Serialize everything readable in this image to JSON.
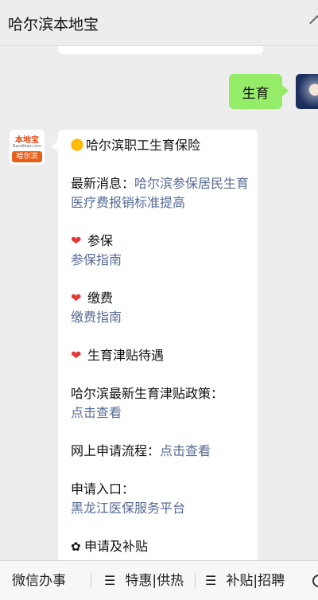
{
  "header": {
    "title": "哈尔滨本地宝"
  },
  "chat": {
    "outgoing_message": "生育",
    "bot_avatar": {
      "top_text": "本地宝",
      "url_text": "Bendibao.com",
      "city_text": "哈尔滨"
    },
    "reply": {
      "title": "哈尔滨职工生育保险",
      "latest_news_label": "最新消息：",
      "latest_news_link": "哈尔滨参保居民生育医疗费报销标准提高",
      "section1_title": "参保",
      "section1_link": "参保指南",
      "section2_title": "缴费",
      "section2_link": "缴费指南",
      "section3_title": "生育津贴待遇",
      "policy_label": "哈尔滨最新生育津贴政策：",
      "policy_link": "点击查看",
      "online_label": "网上申请流程：",
      "online_link": "点击查看",
      "entry_label": "申请入口：",
      "entry_link": "黑龙江医保服务平台",
      "section4_title": "申请及补贴"
    }
  },
  "bottom_menu": [
    {
      "label": "微信办事",
      "has_menu_icon": false
    },
    {
      "label": "特惠|供热",
      "has_menu_icon": true
    },
    {
      "label": "补贴|招聘",
      "has_menu_icon": true
    }
  ],
  "icons": {
    "section_heart": "red-heart-icon",
    "title_sun": "sun-icon",
    "section4": "flower-icon",
    "keyboard": "keyboard-icon"
  }
}
